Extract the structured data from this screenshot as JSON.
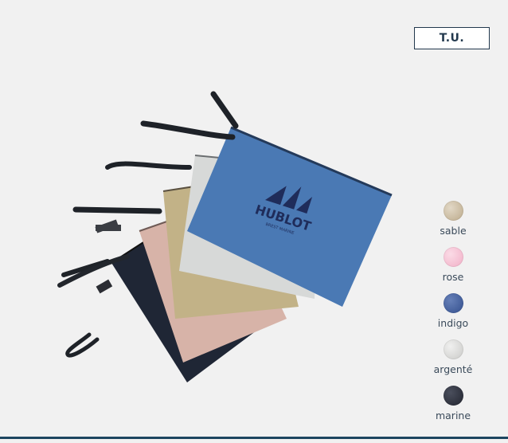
{
  "size_badge": {
    "label": "T.U."
  },
  "product": {
    "brand_name": "HUBLOT",
    "brand_tagline": "BREST MARINE"
  },
  "swatches": [
    {
      "label": "sable",
      "color": "#cbbfa8",
      "icon": "sable-swatch"
    },
    {
      "label": "rose",
      "color": "#f4c2d2",
      "icon": "rose-swatch"
    },
    {
      "label": "indigo",
      "color": "#3e5b98",
      "icon": "indigo-swatch"
    },
    {
      "label": "argenté",
      "color": "#d8d8d6",
      "icon": "argente-swatch"
    },
    {
      "label": "marine",
      "color": "#2c2f3c",
      "icon": "marine-swatch"
    }
  ],
  "colors": {
    "accent": "#1d4560",
    "background": "#f1f1f1"
  }
}
